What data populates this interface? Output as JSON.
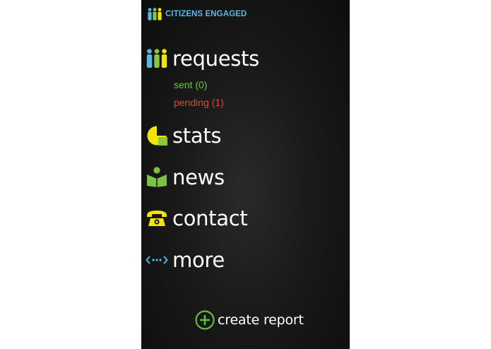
{
  "app": {
    "title": "CITIZENS ENGAGED",
    "logo_icon": "three-people-icon"
  },
  "menu": {
    "requests": {
      "label": "requests",
      "icon": "three-people-icon"
    },
    "sent": {
      "label": "sent (0)"
    },
    "pending": {
      "label": "pending (1)"
    },
    "stats": {
      "label": "stats",
      "icon": "pie-chart-icon"
    },
    "news": {
      "label": "news",
      "icon": "reader-icon"
    },
    "contact": {
      "label": "contact",
      "icon": "telephone-icon"
    },
    "more": {
      "label": "more",
      "icon": "ellipsis-arrows-icon"
    }
  },
  "footer": {
    "create_label": "create report",
    "create_icon": "plus-circle-icon"
  },
  "colors": {
    "background": "#141414",
    "title_blue": "#56b8e6",
    "person_blue": "#56b8e6",
    "person_green": "#8cc63f",
    "person_yellow": "#f2e600",
    "sent_green": "#72c442",
    "pending_red": "#e8452c",
    "stats_yellow": "#f2e600",
    "stats_green": "#8cc63f",
    "news_green": "#7cc242",
    "contact_yellow": "#f2e600",
    "more_blue": "#56b8e6",
    "create_green": "#5fc137",
    "text_white": "#ffffff"
  }
}
